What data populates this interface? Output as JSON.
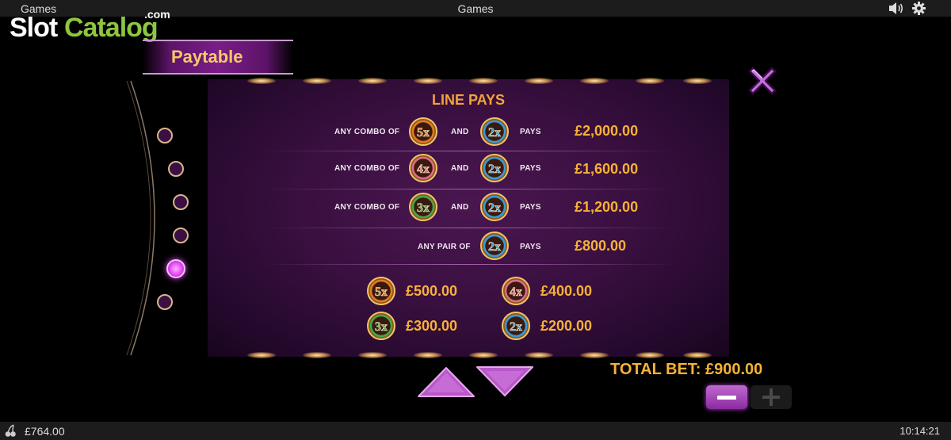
{
  "topbar": {
    "left_title": "Games",
    "center_title": "Games",
    "sound_icon": "speaker-icon",
    "settings_icon": "gear-icon"
  },
  "logo": {
    "slot": "Slot",
    "catalog": "Catalog",
    "dotcom": ".com"
  },
  "banner": {
    "title": "Paytable"
  },
  "panel": {
    "title": "LINE PAYS",
    "rows": [
      {
        "prefix": "ANY COMBO OF",
        "sym1": "5x",
        "and": "AND",
        "sym2": "2x",
        "pays": "PAYS",
        "prize": "£2,000.00"
      },
      {
        "prefix": "ANY COMBO OF",
        "sym1": "4x",
        "and": "AND",
        "sym2": "2x",
        "pays": "PAYS",
        "prize": "£1,600.00"
      },
      {
        "prefix": "ANY COMBO OF",
        "sym1": "3x",
        "and": "AND",
        "sym2": "2x",
        "pays": "PAYS",
        "prize": "£1,200.00"
      },
      {
        "prefix": "ANY PAIR OF",
        "sym2": "2x",
        "pays": "PAYS",
        "prize": "£800.00"
      }
    ],
    "singles": [
      {
        "sym": "5x",
        "prize": "£500.00"
      },
      {
        "sym": "4x",
        "prize": "£400.00"
      },
      {
        "sym": "3x",
        "prize": "£300.00"
      },
      {
        "sym": "2x",
        "prize": "£200.00"
      }
    ]
  },
  "pages": {
    "count": 6,
    "active": 5
  },
  "total_bet": "TOTAL BET: £900.00",
  "bottombar": {
    "balance": "£764.00",
    "clock": "10:14:21"
  },
  "colors": {
    "accent": "#f7b136",
    "purple": "#8a2aa0",
    "sym5x": "#e8781e",
    "sym4x": "#e06a8a",
    "sym3x": "#3faa4a",
    "sym2x": "#3a9ad8"
  }
}
